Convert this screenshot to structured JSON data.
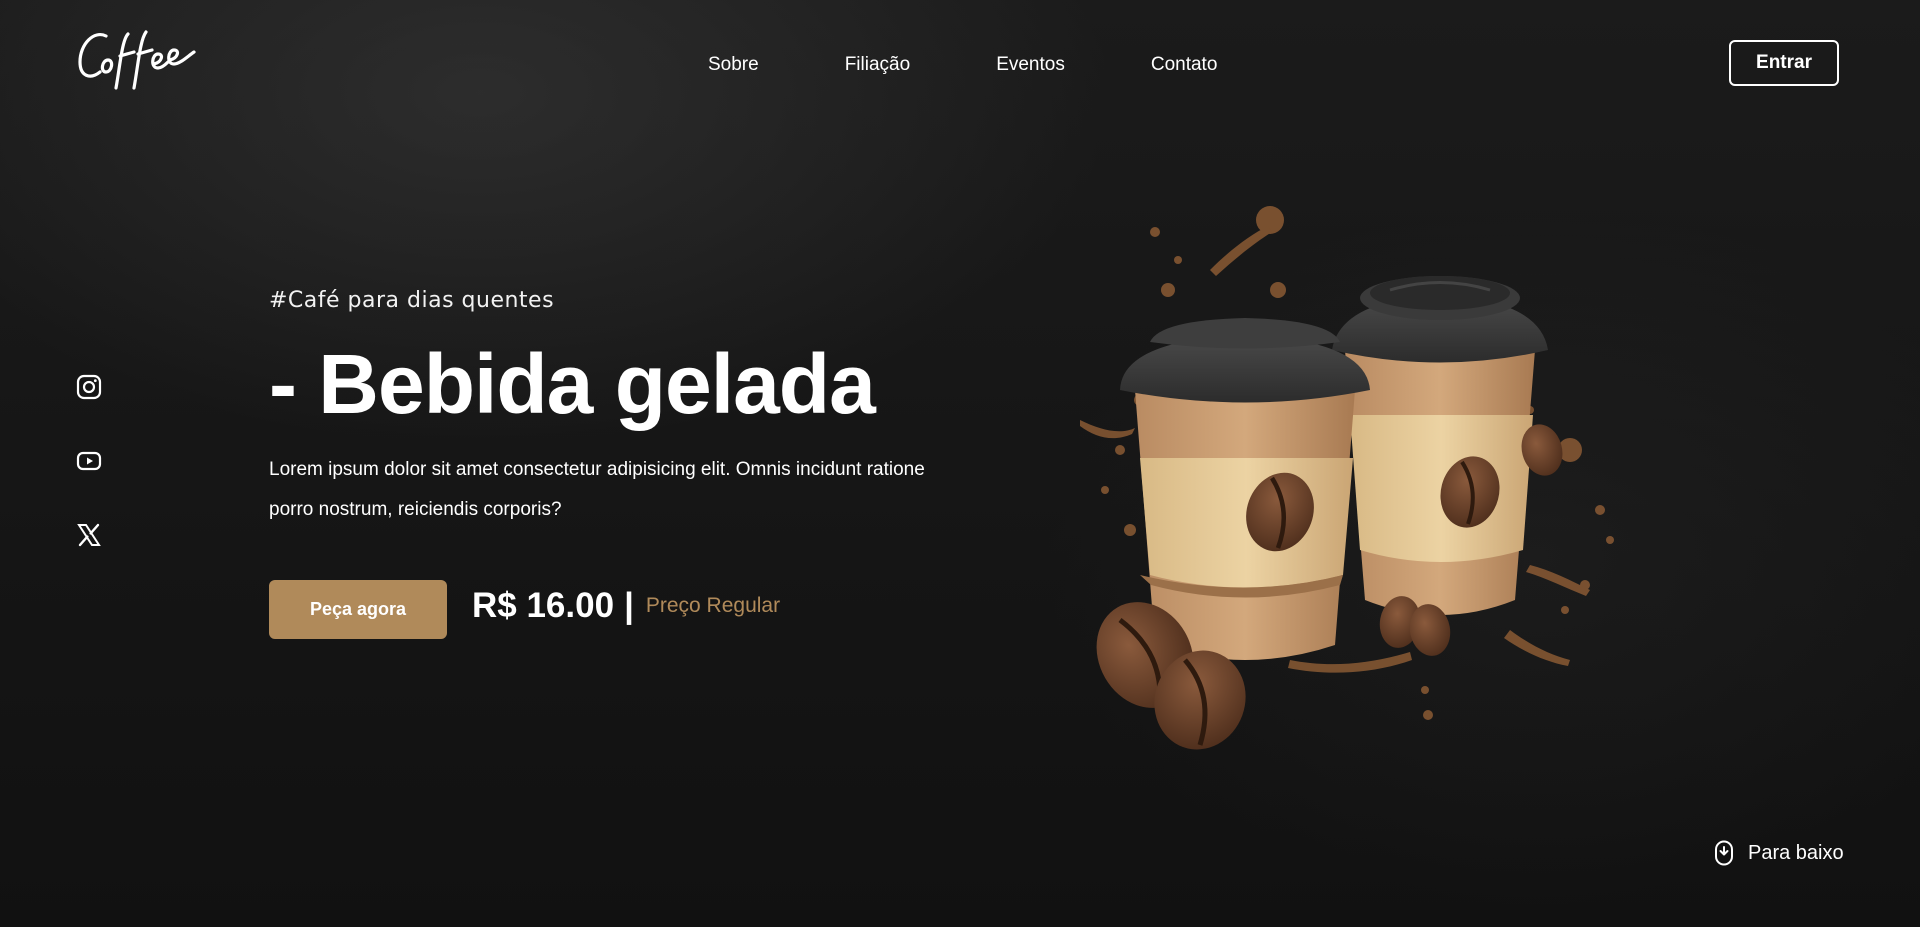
{
  "header": {
    "logo_text": "Coffee",
    "nav": [
      {
        "label": "Sobre"
      },
      {
        "label": "Filiação"
      },
      {
        "label": "Eventos"
      },
      {
        "label": "Contato"
      }
    ],
    "login_label": "Entrar"
  },
  "social": [
    {
      "icon": "instagram-icon"
    },
    {
      "icon": "youtube-icon"
    },
    {
      "icon": "x-twitter-icon"
    }
  ],
  "hero": {
    "tagline": "#Café para dias quentes",
    "headline": "- Bebida gelada",
    "description": "Lorem ipsum dolor sit amet consectetur adipisicing elit. Omnis incidunt ratione porro nostrum, reiciendis corporis?",
    "cta_label": "Peça agora",
    "price": "R$ 16.00",
    "price_separator": "|",
    "price_note": "Preço Regular"
  },
  "illustration": {
    "subject": "two-takeaway-coffee-cups-icon"
  },
  "scroll": {
    "label": "Para baixo"
  },
  "colors": {
    "accent": "#b08a5a",
    "background": "#131313",
    "text": "#ffffff"
  }
}
